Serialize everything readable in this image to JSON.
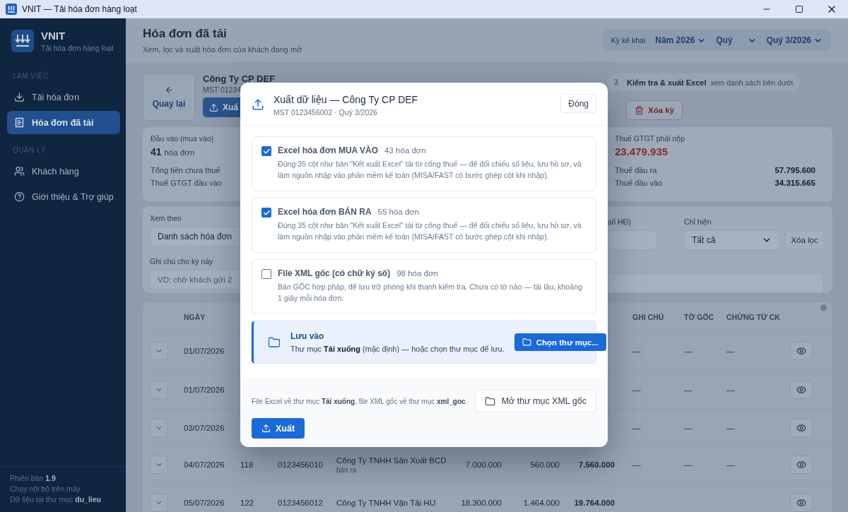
{
  "window": {
    "title": "VNIT — Tải hóa đơn hàng loạt"
  },
  "sidebar": {
    "app_name": "VNIT",
    "app_subtitle": "Tải hóa đơn hàng loạt",
    "sections": [
      {
        "heading": "LÀM VIỆC",
        "items": [
          {
            "label": "Tải hóa đơn",
            "selected": false
          },
          {
            "label": "Hóa đơn đã tải",
            "selected": true
          }
        ]
      },
      {
        "heading": "QUẢN LÝ",
        "items": [
          {
            "label": "Khách hàng",
            "selected": false
          },
          {
            "label": "Giới thiệu & Trợ giúp",
            "selected": false
          }
        ]
      }
    ],
    "footer": [
      "Phiên bản **1.9**",
      "Chạy nội bộ trên máy",
      "Dữ liệu tại thư mục **du_lieu**"
    ]
  },
  "header": {
    "title": "Hóa đơn đã tải",
    "subtitle": "Xem, lọc và xuất hóa đơn của khách đang mở",
    "period_label": "Kỳ kê khai",
    "period_selects": [
      "Năm 2026",
      "Quý",
      "Quý 3/2026"
    ]
  },
  "toolbar": {
    "back": "Quay lại",
    "company": "Công Ty CP DEF",
    "mst": "MST 01234",
    "export": "Xuấ",
    "step": {
      "number": "3",
      "label": "Kiểm tra & xuất Excel",
      "hint": "xem danh sách bên dưới"
    },
    "delete": "Xóa kỳ"
  },
  "summary": {
    "input": {
      "label": "Đầu vào (mua vào)",
      "count": "41",
      "unit": "hóa đơn",
      "rows": [
        "Tổng tiền chưa thuế",
        "Thuế GTGT đầu vào"
      ]
    },
    "tax": {
      "label": "Thuế GTGT phải nộp",
      "amount": "23.479.935",
      "rows": [
        {
          "label": "Thuế đầu ra",
          "value": "57.795.600"
        },
        {
          "label": "Thuế đầu vào",
          "value": "34.315.665"
        }
      ]
    }
  },
  "filters": {
    "view_label": "Xem theo",
    "view_value": "Danh sách hóa đơn",
    "search_label": "số HĐ)",
    "show_label": "Chỉ hiện",
    "show_value": "Tất cả",
    "clear": "Xóa lọc",
    "note_label": "Ghi chú cho kỳ này",
    "note_placeholder": "VD: chờ khách gửi 2"
  },
  "table": {
    "columns": {
      "date": "NGÀY",
      "note": "GHI CHÚ",
      "original": "TỜ GỐC",
      "transfer": "CHỨNG TỪ CK"
    },
    "rows": [
      {
        "date": "01/07/2026",
        "note": "—",
        "original": "—",
        "transfer": "—"
      },
      {
        "date": "01/07/2026",
        "note": "—",
        "original": "—",
        "transfer": "—"
      },
      {
        "date": "03/07/2026",
        "note": "—",
        "original": "—",
        "transfer": "—"
      },
      {
        "date": "04/07/2026",
        "number": "118",
        "mst": "0123456010",
        "company": "Công Ty TNHH Sản Xuất BCD",
        "direction": "bán ra",
        "pretax": "7.000.000",
        "vat": "560.000",
        "total": "7.560.000",
        "note": "—",
        "original": "—",
        "transfer": "—"
      },
      {
        "date": "05/07/2026",
        "number": "122",
        "mst": "0123456012",
        "company": "Công Ty TNHH Vận Tải HIJ",
        "pretax": "18.300.000",
        "vat": "1.464.000",
        "total": "19.764.000"
      }
    ]
  },
  "modal": {
    "title": "Xuất dữ liệu — Công Ty CP DEF",
    "subtitle": "MST 0123456002 · Quý 3/2026",
    "close": "Đóng",
    "options": [
      {
        "title": "Excel hóa đơn MUA VÀO",
        "count": "43 hóa đơn",
        "description": "Đúng 35 cột như bản \"Kết xuất Excel\" tải từ cổng thuế — để đối chiếu số liệu, lưu hồ sơ, và làm nguồn nhập vào phần mềm kế toán (MISA/FAST có bước ghép cột khi nhập).",
        "checked": true
      },
      {
        "title": "Excel hóa đơn BÁN RA",
        "count": "55 hóa đơn",
        "description": "Đúng 35 cột như bản \"Kết xuất Excel\" tải từ cổng thuế — để đối chiếu số liệu, lưu hồ sơ, và làm nguồn nhập vào phần mềm kế toán (MISA/FAST có bước ghép cột khi nhập).",
        "checked": true
      },
      {
        "title": "File XML gốc (có chữ ký số)",
        "count": "98 hóa đơn",
        "description": "Bản GỐC hợp pháp, để lưu trữ phòng khi thanh kiểm tra. Chưa có tờ nào — tải lâu, khoảng 1 giây mỗi hóa đơn.",
        "checked": false
      }
    ],
    "save": {
      "title": "Lưu vào",
      "text": "Thư mục **Tải xuống** (mặc định) — hoặc chọn thư mục để lưu.",
      "button": "Chọn thư mục..."
    },
    "footer_note": "File Excel về thư mục **Tải xuống**, file XML gốc về thư mục **xml_goc**.",
    "open_folder": "Mở thư mục XML gốc",
    "submit": "Xuất"
  }
}
